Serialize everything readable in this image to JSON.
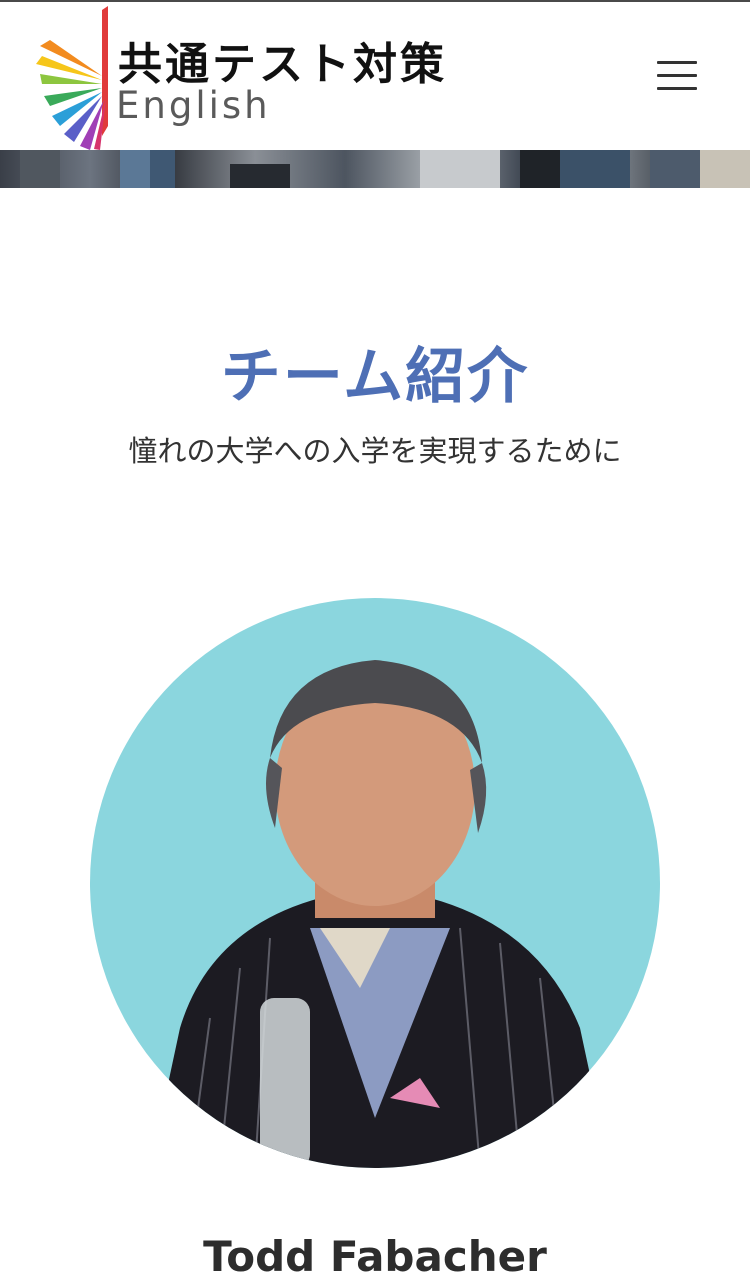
{
  "header": {
    "logo_title": "共通テスト対策",
    "logo_subtitle": "English",
    "menu_icon": "hamburger-menu-icon"
  },
  "section": {
    "title": "チーム紹介",
    "subtitle": "憧れの大学への入学を実現するために"
  },
  "team": {
    "members": [
      {
        "name": "Todd Fabacher"
      }
    ]
  },
  "colors": {
    "title_accent": "#4e6fb5",
    "photo_background": "#8bd6de",
    "text_dark": "#2d2d2d"
  }
}
